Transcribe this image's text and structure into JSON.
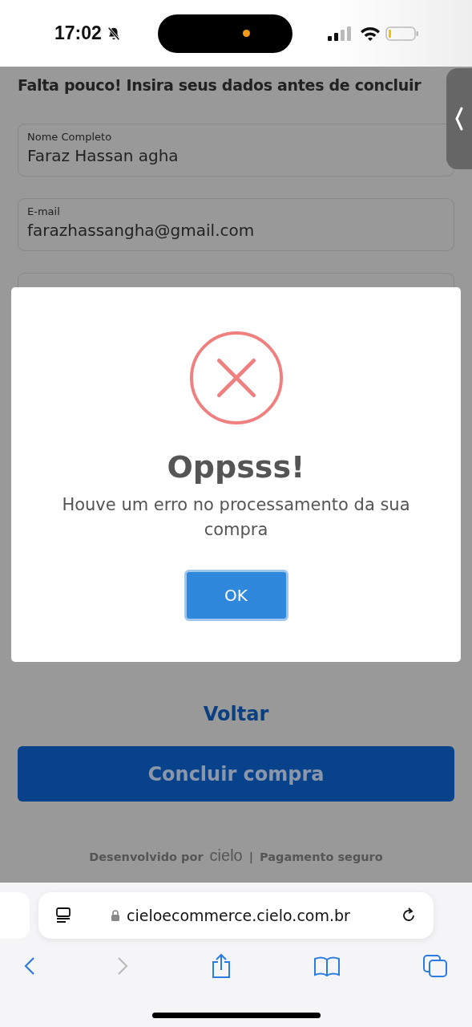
{
  "status_bar": {
    "time": "17:02"
  },
  "form": {
    "heading": "Falta pouco! Insira seus dados antes de concluir",
    "fields": [
      {
        "label": "Nome Completo",
        "value": "Faraz Hassan agha"
      },
      {
        "label": "E-mail",
        "value": "farazhassangha@gmail.com"
      },
      {
        "kind": "covered"
      }
    ],
    "back_link": "Voltar",
    "submit_button": "Concluir compra"
  },
  "footer": {
    "prefix": "Desenvolvido por",
    "brand": "cielo",
    "separator": "|",
    "secure": "Pagamento seguro"
  },
  "dialog": {
    "title": "Oppsss!",
    "message": "Houve um erro no processamento da sua compra",
    "button": "OK"
  },
  "browser": {
    "url": "cieloecommerce.cielo.com.br",
    "forward_disabled": true
  }
}
